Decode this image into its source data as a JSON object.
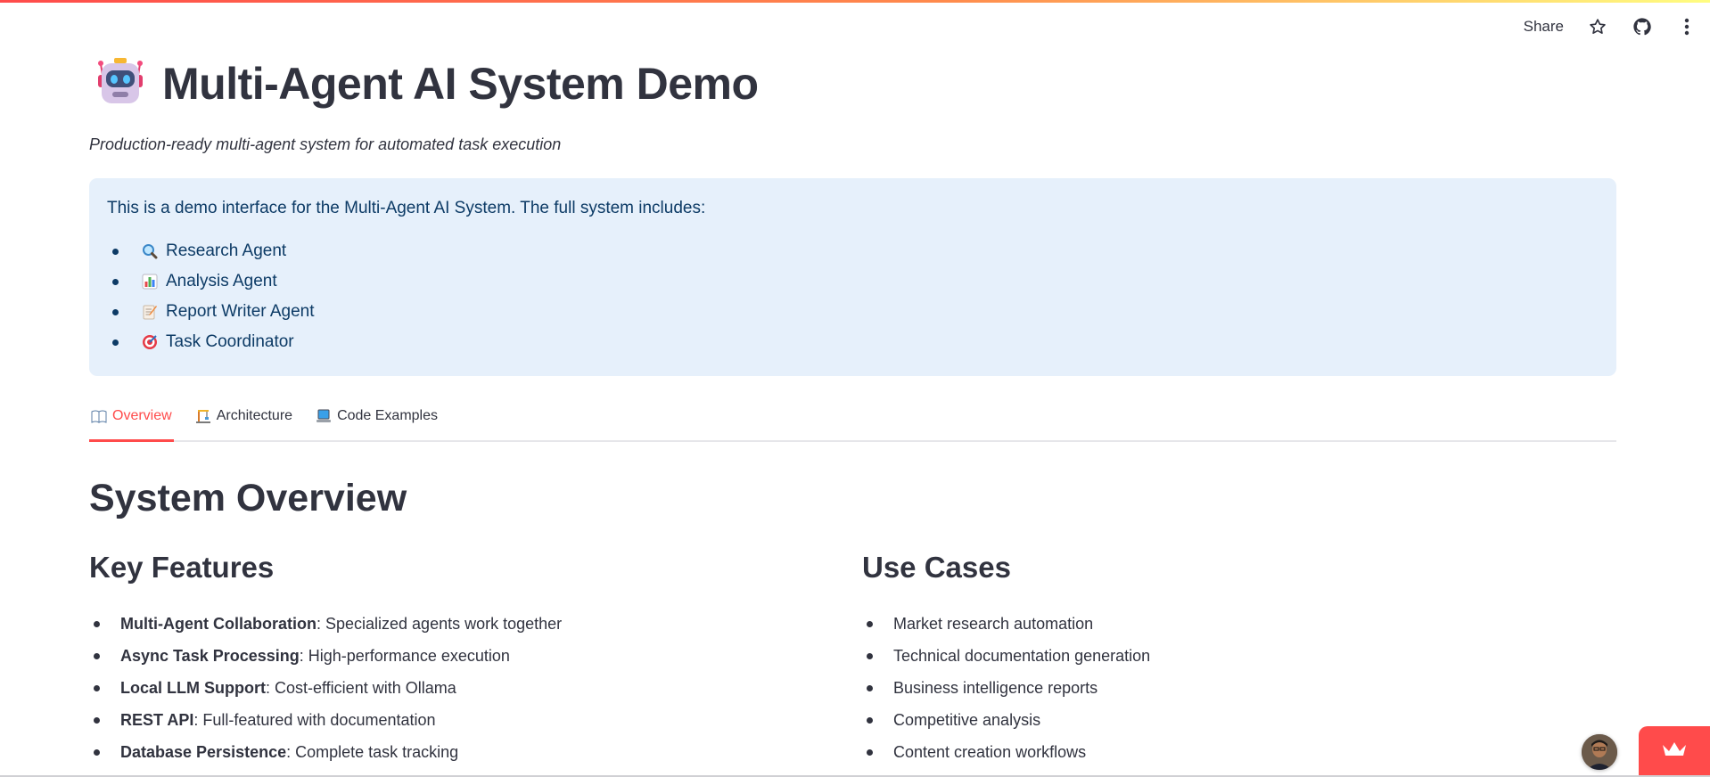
{
  "toolbar": {
    "share_label": "Share",
    "icons": [
      "star-icon",
      "github-icon",
      "more-vertical-icon"
    ]
  },
  "header": {
    "icon": "robot-face-icon",
    "title": "Multi-Agent AI System Demo",
    "subtitle": "Production-ready multi-agent system for automated task execution"
  },
  "info": {
    "intro": "This is a demo interface for the Multi-Agent AI System. The full system includes:",
    "items": [
      {
        "icon": "magnifier-icon",
        "label": "Research Agent"
      },
      {
        "icon": "bar-chart-icon",
        "label": "Analysis Agent"
      },
      {
        "icon": "memo-icon",
        "label": "Report Writer Agent"
      },
      {
        "icon": "target-icon",
        "label": "Task Coordinator"
      }
    ]
  },
  "tabs": [
    {
      "icon": "open-book-icon",
      "label": "Overview",
      "active": true
    },
    {
      "icon": "construction-icon",
      "label": "Architecture",
      "active": false
    },
    {
      "icon": "laptop-icon",
      "label": "Code Examples",
      "active": false
    }
  ],
  "overview": {
    "heading": "System Overview",
    "features": {
      "heading": "Key Features",
      "items": [
        {
          "bold": "Multi-Agent Collaboration",
          "text": ": Specialized agents work together"
        },
        {
          "bold": "Async Task Processing",
          "text": ": High-performance execution"
        },
        {
          "bold": "Local LLM Support",
          "text": ": Cost-efficient with Ollama"
        },
        {
          "bold": "REST API",
          "text": ": Full-featured with documentation"
        },
        {
          "bold": "Database Persistence",
          "text": ": Complete task tracking"
        }
      ]
    },
    "use_cases": {
      "heading": "Use Cases",
      "items": [
        "Market research automation",
        "Technical documentation generation",
        "Business intelligence reports",
        "Competitive analysis",
        "Content creation workflows"
      ]
    }
  },
  "colors": {
    "accent": "#ff4b4b",
    "info_bg": "#e6f0fb",
    "info_text": "#0d3b66",
    "text": "#31333f"
  }
}
